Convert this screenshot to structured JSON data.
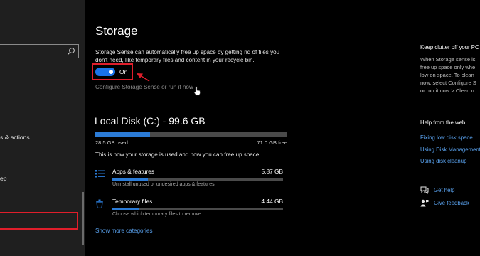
{
  "nav": {
    "items": [
      {
        "label": "s & actions"
      },
      {
        "label": "ep"
      }
    ]
  },
  "storage": {
    "title": "Storage",
    "description": "Storage Sense can automatically free up space by getting rid of files you don't need, like temporary files and content in your recycle bin.",
    "toggle": {
      "state": "On",
      "on": true
    },
    "configure_link": "Configure Storage Sense or run it now"
  },
  "disk": {
    "title": "Local Disk (C:) - 99.6 GB",
    "used_label": "28.5 GB used",
    "free_label": "71.0 GB free",
    "used_fraction": 0.286,
    "summary": "This is how your storage is used and how you can free up space.",
    "categories": [
      {
        "name": "Apps & features",
        "size": "5.87 GB",
        "description": "Uninstall unused or undesired apps & features",
        "icon": "apps-list-icon",
        "fill_fraction": 0.21
      },
      {
        "name": "Temporary files",
        "size": "4.44 GB",
        "description": "Choose which temporary files to remove",
        "icon": "trash-icon",
        "fill_fraction": 0.16
      }
    ],
    "show_more": "Show more categories"
  },
  "side": {
    "clutter_title": "Keep clutter off your PC",
    "clutter_lines": [
      "When Storage sense is",
      "free up space only whe",
      "low on space. To clean",
      "now, select Configure S",
      "or run it now > Clean n"
    ],
    "help_title": "Help from the web",
    "links": [
      "Fixing low disk space",
      "Using Disk Management",
      "Using disk cleanup"
    ],
    "get_help": "Get help",
    "give_feedback": "Give feedback"
  },
  "colors": {
    "accent": "#2b7bd6",
    "toggle": "#1a73e8",
    "highlight": "#e01e2b",
    "link": "#5aa3f0"
  }
}
